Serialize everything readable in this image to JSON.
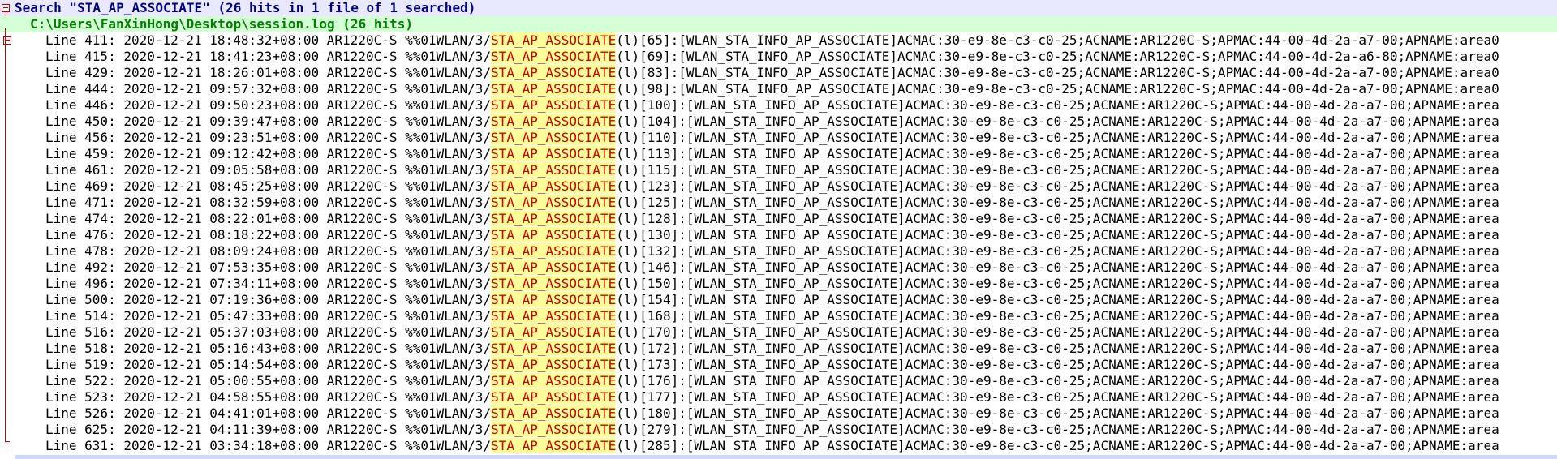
{
  "search": {
    "header": "Search \"STA_AP_ASSOCIATE\" (26 hits in 1 file of 1 searched)",
    "file_header": "C:\\Users\\FanXinHong\\Desktop\\session.log (26 hits)",
    "term": "STA_AP_ASSOCIATE"
  },
  "colors": {
    "search_header_bg": "#e8e8ff",
    "file_header_bg": "#d5ffd5",
    "file_header_text": "#008000",
    "match_text": "#c80000",
    "match_bg": "#ffff99"
  },
  "hits": [
    {
      "prefix": "Line 411: 2020-12-21 18:48:32+08:00 AR1220C-S %%01WLAN/3/",
      "match": "STA_AP_ASSOCIATE",
      "suffix": "(l)[65]:[WLAN_STA_INFO_AP_ASSOCIATE]ACMAC:30-e9-8e-c3-c0-25;ACNAME:AR1220C-S;APMAC:44-00-4d-2a-a7-00;APNAME:area0"
    },
    {
      "prefix": "Line 415: 2020-12-21 18:41:23+08:00 AR1220C-S %%01WLAN/3/",
      "match": "STA_AP_ASSOCIATE",
      "suffix": "(l)[69]:[WLAN_STA_INFO_AP_ASSOCIATE]ACMAC:30-e9-8e-c3-c0-25;ACNAME:AR1220C-S;APMAC:44-00-4d-2a-a6-80;APNAME:area0"
    },
    {
      "prefix": "Line 429: 2020-12-21 18:26:01+08:00 AR1220C-S %%01WLAN/3/",
      "match": "STA_AP_ASSOCIATE",
      "suffix": "(l)[83]:[WLAN_STA_INFO_AP_ASSOCIATE]ACMAC:30-e9-8e-c3-c0-25;ACNAME:AR1220C-S;APMAC:44-00-4d-2a-a7-00;APNAME:area0"
    },
    {
      "prefix": "Line 444: 2020-12-21 09:57:32+08:00 AR1220C-S %%01WLAN/3/",
      "match": "STA_AP_ASSOCIATE",
      "suffix": "(l)[98]:[WLAN_STA_INFO_AP_ASSOCIATE]ACMAC:30-e9-8e-c3-c0-25;ACNAME:AR1220C-S;APMAC:44-00-4d-2a-a7-00;APNAME:area0"
    },
    {
      "prefix": "Line 446: 2020-12-21 09:50:23+08:00 AR1220C-S %%01WLAN/3/",
      "match": "STA_AP_ASSOCIATE",
      "suffix": "(l)[100]:[WLAN_STA_INFO_AP_ASSOCIATE]ACMAC:30-e9-8e-c3-c0-25;ACNAME:AR1220C-S;APMAC:44-00-4d-2a-a7-00;APNAME:area"
    },
    {
      "prefix": "Line 450: 2020-12-21 09:39:47+08:00 AR1220C-S %%01WLAN/3/",
      "match": "STA_AP_ASSOCIATE",
      "suffix": "(l)[104]:[WLAN_STA_INFO_AP_ASSOCIATE]ACMAC:30-e9-8e-c3-c0-25;ACNAME:AR1220C-S;APMAC:44-00-4d-2a-a7-00;APNAME:area"
    },
    {
      "prefix": "Line 456: 2020-12-21 09:23:51+08:00 AR1220C-S %%01WLAN/3/",
      "match": "STA_AP_ASSOCIATE",
      "suffix": "(l)[110]:[WLAN_STA_INFO_AP_ASSOCIATE]ACMAC:30-e9-8e-c3-c0-25;ACNAME:AR1220C-S;APMAC:44-00-4d-2a-a7-00;APNAME:area"
    },
    {
      "prefix": "Line 459: 2020-12-21 09:12:42+08:00 AR1220C-S %%01WLAN/3/",
      "match": "STA_AP_ASSOCIATE",
      "suffix": "(l)[113]:[WLAN_STA_INFO_AP_ASSOCIATE]ACMAC:30-e9-8e-c3-c0-25;ACNAME:AR1220C-S;APMAC:44-00-4d-2a-a7-00;APNAME:area"
    },
    {
      "prefix": "Line 461: 2020-12-21 09:05:58+08:00 AR1220C-S %%01WLAN/3/",
      "match": "STA_AP_ASSOCIATE",
      "suffix": "(l)[115]:[WLAN_STA_INFO_AP_ASSOCIATE]ACMAC:30-e9-8e-c3-c0-25;ACNAME:AR1220C-S;APMAC:44-00-4d-2a-a7-00;APNAME:area"
    },
    {
      "prefix": "Line 469: 2020-12-21 08:45:25+08:00 AR1220C-S %%01WLAN/3/",
      "match": "STA_AP_ASSOCIATE",
      "suffix": "(l)[123]:[WLAN_STA_INFO_AP_ASSOCIATE]ACMAC:30-e9-8e-c3-c0-25;ACNAME:AR1220C-S;APMAC:44-00-4d-2a-a7-00;APNAME:area"
    },
    {
      "prefix": "Line 471: 2020-12-21 08:32:59+08:00 AR1220C-S %%01WLAN/3/",
      "match": "STA_AP_ASSOCIATE",
      "suffix": "(l)[125]:[WLAN_STA_INFO_AP_ASSOCIATE]ACMAC:30-e9-8e-c3-c0-25;ACNAME:AR1220C-S;APMAC:44-00-4d-2a-a7-00;APNAME:area"
    },
    {
      "prefix": "Line 474: 2020-12-21 08:22:01+08:00 AR1220C-S %%01WLAN/3/",
      "match": "STA_AP_ASSOCIATE",
      "suffix": "(l)[128]:[WLAN_STA_INFO_AP_ASSOCIATE]ACMAC:30-e9-8e-c3-c0-25;ACNAME:AR1220C-S;APMAC:44-00-4d-2a-a7-00;APNAME:area"
    },
    {
      "prefix": "Line 476: 2020-12-21 08:18:22+08:00 AR1220C-S %%01WLAN/3/",
      "match": "STA_AP_ASSOCIATE",
      "suffix": "(l)[130]:[WLAN_STA_INFO_AP_ASSOCIATE]ACMAC:30-e9-8e-c3-c0-25;ACNAME:AR1220C-S;APMAC:44-00-4d-2a-a7-00;APNAME:area"
    },
    {
      "prefix": "Line 478: 2020-12-21 08:09:24+08:00 AR1220C-S %%01WLAN/3/",
      "match": "STA_AP_ASSOCIATE",
      "suffix": "(l)[132]:[WLAN_STA_INFO_AP_ASSOCIATE]ACMAC:30-e9-8e-c3-c0-25;ACNAME:AR1220C-S;APMAC:44-00-4d-2a-a7-00;APNAME:area"
    },
    {
      "prefix": "Line 492: 2020-12-21 07:53:35+08:00 AR1220C-S %%01WLAN/3/",
      "match": "STA_AP_ASSOCIATE",
      "suffix": "(l)[146]:[WLAN_STA_INFO_AP_ASSOCIATE]ACMAC:30-e9-8e-c3-c0-25;ACNAME:AR1220C-S;APMAC:44-00-4d-2a-a7-00;APNAME:area"
    },
    {
      "prefix": "Line 496: 2020-12-21 07:34:11+08:00 AR1220C-S %%01WLAN/3/",
      "match": "STA_AP_ASSOCIATE",
      "suffix": "(l)[150]:[WLAN_STA_INFO_AP_ASSOCIATE]ACMAC:30-e9-8e-c3-c0-25;ACNAME:AR1220C-S;APMAC:44-00-4d-2a-a7-00;APNAME:area"
    },
    {
      "prefix": "Line 500: 2020-12-21 07:19:36+08:00 AR1220C-S %%01WLAN/3/",
      "match": "STA_AP_ASSOCIATE",
      "suffix": "(l)[154]:[WLAN_STA_INFO_AP_ASSOCIATE]ACMAC:30-e9-8e-c3-c0-25;ACNAME:AR1220C-S;APMAC:44-00-4d-2a-a7-00;APNAME:area"
    },
    {
      "prefix": "Line 514: 2020-12-21 05:47:33+08:00 AR1220C-S %%01WLAN/3/",
      "match": "STA_AP_ASSOCIATE",
      "suffix": "(l)[168]:[WLAN_STA_INFO_AP_ASSOCIATE]ACMAC:30-e9-8e-c3-c0-25;ACNAME:AR1220C-S;APMAC:44-00-4d-2a-a7-00;APNAME:area"
    },
    {
      "prefix": "Line 516: 2020-12-21 05:37:03+08:00 AR1220C-S %%01WLAN/3/",
      "match": "STA_AP_ASSOCIATE",
      "suffix": "(l)[170]:[WLAN_STA_INFO_AP_ASSOCIATE]ACMAC:30-e9-8e-c3-c0-25;ACNAME:AR1220C-S;APMAC:44-00-4d-2a-a7-00;APNAME:area"
    },
    {
      "prefix": "Line 518: 2020-12-21 05:16:43+08:00 AR1220C-S %%01WLAN/3/",
      "match": "STA_AP_ASSOCIATE",
      "suffix": "(l)[172]:[WLAN_STA_INFO_AP_ASSOCIATE]ACMAC:30-e9-8e-c3-c0-25;ACNAME:AR1220C-S;APMAC:44-00-4d-2a-a7-00;APNAME:area"
    },
    {
      "prefix": "Line 519: 2020-12-21 05:14:54+08:00 AR1220C-S %%01WLAN/3/",
      "match": "STA_AP_ASSOCIATE",
      "suffix": "(l)[173]:[WLAN_STA_INFO_AP_ASSOCIATE]ACMAC:30-e9-8e-c3-c0-25;ACNAME:AR1220C-S;APMAC:44-00-4d-2a-a7-00;APNAME:area"
    },
    {
      "prefix": "Line 522: 2020-12-21 05:00:55+08:00 AR1220C-S %%01WLAN/3/",
      "match": "STA_AP_ASSOCIATE",
      "suffix": "(l)[176]:[WLAN_STA_INFO_AP_ASSOCIATE]ACMAC:30-e9-8e-c3-c0-25;ACNAME:AR1220C-S;APMAC:44-00-4d-2a-a7-00;APNAME:area"
    },
    {
      "prefix": "Line 523: 2020-12-21 04:58:55+08:00 AR1220C-S %%01WLAN/3/",
      "match": "STA_AP_ASSOCIATE",
      "suffix": "(l)[177]:[WLAN_STA_INFO_AP_ASSOCIATE]ACMAC:30-e9-8e-c3-c0-25;ACNAME:AR1220C-S;APMAC:44-00-4d-2a-a7-00;APNAME:area"
    },
    {
      "prefix": "Line 526: 2020-12-21 04:41:01+08:00 AR1220C-S %%01WLAN/3/",
      "match": "STA_AP_ASSOCIATE",
      "suffix": "(l)[180]:[WLAN_STA_INFO_AP_ASSOCIATE]ACMAC:30-e9-8e-c3-c0-25;ACNAME:AR1220C-S;APMAC:44-00-4d-2a-a7-00;APNAME:area"
    },
    {
      "prefix": "Line 625: 2020-12-21 04:11:39+08:00 AR1220C-S %%01WLAN/3/",
      "match": "STA_AP_ASSOCIATE",
      "suffix": "(l)[279]:[WLAN_STA_INFO_AP_ASSOCIATE]ACMAC:30-e9-8e-c3-c0-25;ACNAME:AR1220C-S;APMAC:44-00-4d-2a-a7-00;APNAME:area"
    },
    {
      "prefix": "Line 631: 2020-12-21 03:34:18+08:00 AR1220C-S %%01WLAN/3/",
      "match": "STA_AP_ASSOCIATE",
      "suffix": "(l)[285]:[WLAN_STA_INFO_AP_ASSOCIATE]ACMAC:30-e9-8e-c3-c0-25;ACNAME:AR1220C-S;APMAC:44-00-4d-2a-a7-00;APNAME:area"
    }
  ]
}
